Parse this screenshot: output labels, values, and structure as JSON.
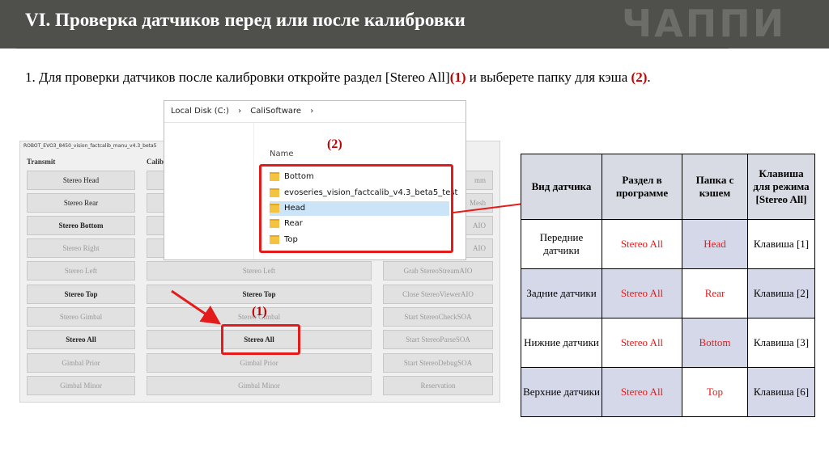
{
  "header": {
    "title": "VI. Проверка датчиков перед или после калибровки",
    "logo": "ЧАППИ",
    "bg": "#4f504b"
  },
  "instruction": {
    "text1": "1.  Для проверки датчиков после калибровки откройте раздел [Stereo All]",
    "ref1": "(1)",
    "text2": " и выберете папку для кэша ",
    "ref2": "(2)",
    "text3": "."
  },
  "app": {
    "window_title": "ROBOT_EVO3_8450_vision_factcalib_manu_v4.3_beta5",
    "col1_header": "Transmit",
    "col2_header": "Calib",
    "col1_buttons": [
      "Stereo Head",
      "Stereo Rear",
      "Stereo Bottom",
      "Stereo Right",
      "Stereo Left",
      "Stereo Top",
      "Stereo Gimbal",
      "Stereo All",
      "Gimbal Prior",
      "Gimbal Minor"
    ],
    "col2_buttons": [
      "Stereo Left",
      "Stereo Top",
      "Stereo Gimbal",
      "Stereo All",
      "Gimbal Prior",
      "Gimbal Minor"
    ],
    "col3_buttons": [
      "mm",
      "Mesh",
      "AIO",
      "AIO",
      "Grab StereoStreamAIO",
      "Close StereoViewerAIO",
      "Start StereoCheckSOA",
      "Start StereoParseSOA",
      "Start StereoDebugSOA",
      "Reservation"
    ]
  },
  "explorer": {
    "path": [
      "Local Disk (C:)",
      "›",
      "CaliSoftware",
      "›"
    ],
    "name_col": "Name",
    "folders": [
      "Bottom",
      "evoseries_vision_factcalib_v4.3_beta5_test",
      "Head",
      "Rear",
      "Top"
    ]
  },
  "annotations": {
    "label1": "(1)",
    "label2": "(2)",
    "color": "#e31b1b"
  },
  "table": {
    "headers": [
      "Вид датчика",
      "Раздел в программе",
      "Папка с кэшем",
      "Клавиша для режима [Stereo All]"
    ],
    "rows": [
      [
        "Передние датчики",
        "Stereo All",
        "Head",
        "Клавиша [1]"
      ],
      [
        "Задние датчики",
        "Stereo All",
        "Rear",
        "Клавиша [2]"
      ],
      [
        "Нижние датчики",
        "Stereo All",
        "Bottom",
        "Клавиша [3]"
      ],
      [
        "Верхние датчики",
        "Stereo All",
        "Top",
        "Клавиша [6]"
      ]
    ]
  }
}
